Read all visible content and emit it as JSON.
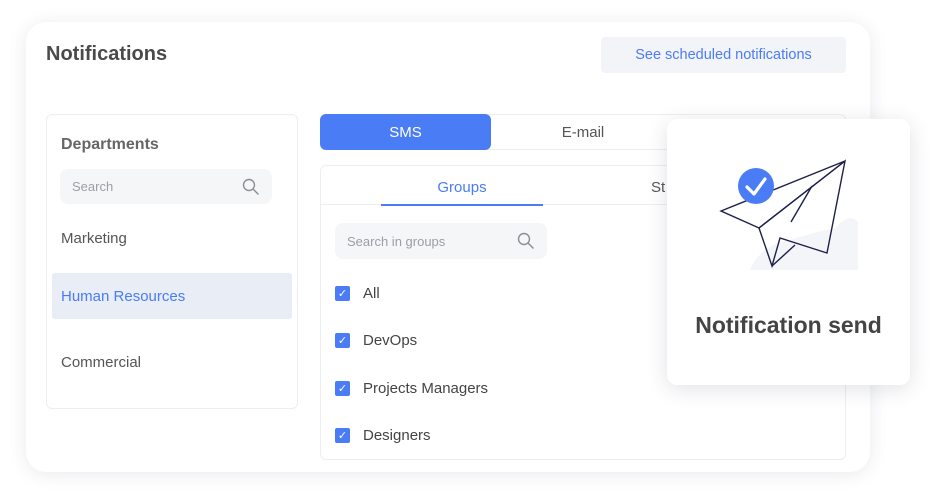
{
  "header": {
    "title": "Notifications",
    "scheduled_button": "See scheduled notifications"
  },
  "departments": {
    "title": "Departments",
    "search_placeholder": "Search",
    "items": [
      {
        "label": "Marketing"
      },
      {
        "label": "Human Resources",
        "selected": true
      },
      {
        "label": "Commercial"
      }
    ]
  },
  "channel_tabs": [
    {
      "label": "SMS",
      "active": true
    },
    {
      "label": "E-mail"
    }
  ],
  "sub_tabs": [
    {
      "label": "Groups",
      "active": true
    },
    {
      "label": "St"
    }
  ],
  "groups": {
    "search_placeholder": "Search in groups",
    "items": [
      {
        "label": "All",
        "checked": true
      },
      {
        "label": "DevOps",
        "checked": true
      },
      {
        "label": "Projects Managers",
        "checked": true
      },
      {
        "label": "Designers",
        "checked": true
      }
    ]
  },
  "toast": {
    "text": "Notification send",
    "icon": "paper-plane-check-icon"
  },
  "colors": {
    "accent": "#4a7cf6",
    "selected_bg": "#e8edf6"
  }
}
